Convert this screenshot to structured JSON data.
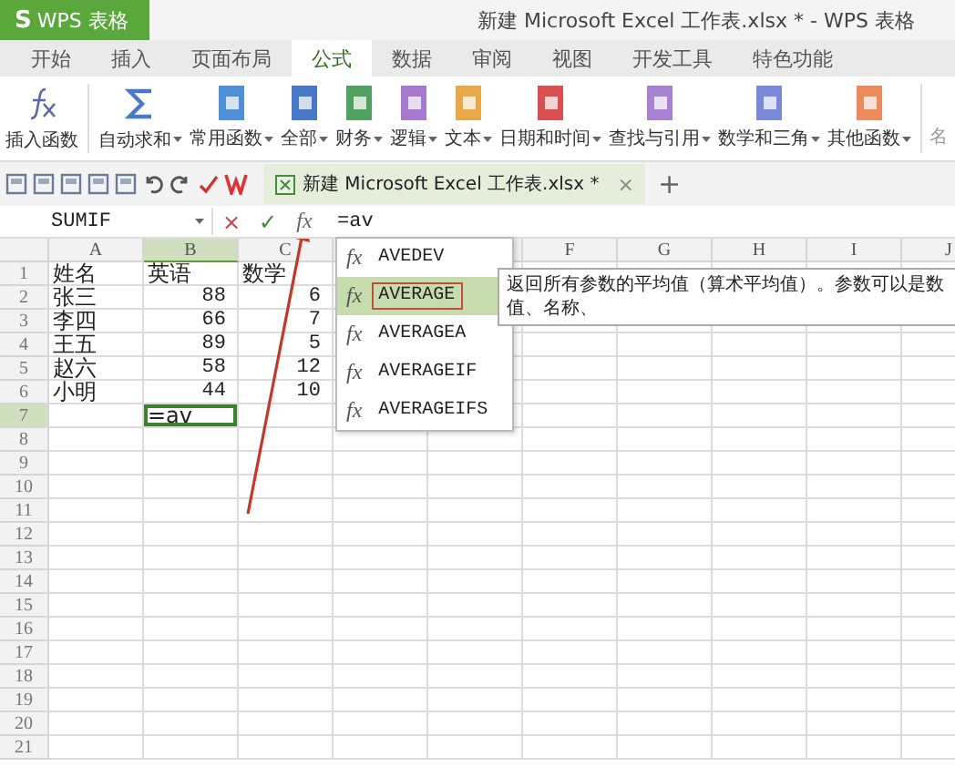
{
  "window": {
    "app_logo": "S",
    "app_name": "WPS 表格",
    "title": "新建 Microsoft Excel 工作表.xlsx * - WPS 表格"
  },
  "menu_tabs": [
    {
      "label": "开始",
      "selected": false
    },
    {
      "label": "插入",
      "selected": false
    },
    {
      "label": "页面布局",
      "selected": false
    },
    {
      "label": "公式",
      "selected": true
    },
    {
      "label": "数据",
      "selected": false
    },
    {
      "label": "审阅",
      "selected": false
    },
    {
      "label": "视图",
      "selected": false
    },
    {
      "label": "开发工具",
      "selected": false
    },
    {
      "label": "特色功能",
      "selected": false
    }
  ],
  "ribbon": {
    "buttons": [
      {
        "kind": "fx",
        "label": "插入函数",
        "dropdown": false
      },
      {
        "kind": "sigma",
        "label": "自动求和",
        "dropdown": true
      },
      {
        "kind": "book",
        "label": "常用函数",
        "dropdown": true,
        "color": "#4f8fd8"
      },
      {
        "kind": "book",
        "label": "全部",
        "dropdown": true,
        "color": "#4a78c8"
      },
      {
        "kind": "book",
        "label": "财务",
        "dropdown": true,
        "color": "#52a060"
      },
      {
        "kind": "book",
        "label": "逻辑",
        "dropdown": true,
        "color": "#a679cc"
      },
      {
        "kind": "book",
        "label": "文本",
        "dropdown": true,
        "color": "#e8a848"
      },
      {
        "kind": "book",
        "label": "日期和时间",
        "dropdown": true,
        "color": "#d85050"
      },
      {
        "kind": "book",
        "label": "查找与引用",
        "dropdown": true,
        "color": "#a882d0"
      },
      {
        "kind": "book",
        "label": "数学和三角",
        "dropdown": true,
        "color": "#7a88d8"
      },
      {
        "kind": "book",
        "label": "其他函数",
        "dropdown": true,
        "color": "#ec8a5c"
      }
    ],
    "cut_label": "名"
  },
  "document_tab": {
    "label": "新建 Microsoft Excel 工作表.xlsx *",
    "close": "×",
    "new_tab": "+"
  },
  "formula_bar": {
    "name_box": "SUMIF",
    "cancel": "×",
    "confirm": "✓",
    "fx": "fx",
    "value": "=av"
  },
  "sheet": {
    "columns": [
      {
        "label": "A",
        "selected": false
      },
      {
        "label": "B",
        "selected": true
      },
      {
        "label": "C",
        "selected": false
      },
      {
        "label": "F",
        "selected": false
      },
      {
        "label": "G",
        "selected": false
      },
      {
        "label": "H",
        "selected": false
      },
      {
        "label": "I",
        "selected": false
      },
      {
        "label": "J",
        "selected": false
      }
    ],
    "rows": [
      {
        "number": "1",
        "selected": false,
        "cells": [
          {
            "kind": "text",
            "text": "姓名"
          },
          {
            "kind": "text",
            "text": "英语"
          },
          {
            "kind": "text",
            "text": "数学"
          }
        ]
      },
      {
        "number": "2",
        "selected": false,
        "cells": [
          {
            "kind": "text",
            "text": "张三"
          },
          {
            "kind": "number",
            "text": "88"
          },
          {
            "kind": "number",
            "text": "6"
          }
        ]
      },
      {
        "number": "3",
        "selected": false,
        "cells": [
          {
            "kind": "text",
            "text": "李四"
          },
          {
            "kind": "number",
            "text": "66"
          },
          {
            "kind": "number",
            "text": "7"
          }
        ]
      },
      {
        "number": "4",
        "selected": false,
        "cells": [
          {
            "kind": "text",
            "text": "王五"
          },
          {
            "kind": "number",
            "text": "89"
          },
          {
            "kind": "number",
            "text": "5"
          }
        ]
      },
      {
        "number": "5",
        "selected": false,
        "cells": [
          {
            "kind": "text",
            "text": "赵六"
          },
          {
            "kind": "number",
            "text": "58"
          },
          {
            "kind": "number",
            "text": "12"
          }
        ]
      },
      {
        "number": "6",
        "selected": false,
        "cells": [
          {
            "kind": "text",
            "text": "小明"
          },
          {
            "kind": "number",
            "text": "44"
          },
          {
            "kind": "number",
            "text": "10"
          }
        ]
      },
      {
        "number": "7",
        "selected": true,
        "cells": [
          null,
          {
            "kind": "text",
            "text": "=av",
            "active": true
          }
        ]
      },
      {
        "number": "8",
        "selected": false
      },
      {
        "number": "9",
        "selected": false
      },
      {
        "number": "10",
        "selected": false
      },
      {
        "number": "11",
        "selected": false
      },
      {
        "number": "12",
        "selected": false
      },
      {
        "number": "13",
        "selected": false
      },
      {
        "number": "14",
        "selected": false
      },
      {
        "number": "15",
        "selected": false
      },
      {
        "number": "16",
        "selected": false
      },
      {
        "number": "17",
        "selected": false
      },
      {
        "number": "18",
        "selected": false
      },
      {
        "number": "19",
        "selected": false
      },
      {
        "number": "20",
        "selected": false
      },
      {
        "number": "21",
        "selected": false
      }
    ]
  },
  "autocomplete": {
    "items": [
      {
        "icon": "fx",
        "name": "AVEDEV",
        "selected": false
      },
      {
        "icon": "fx",
        "name": "AVERAGE",
        "selected": true
      },
      {
        "icon": "fx",
        "name": "AVERAGEA",
        "selected": false
      },
      {
        "icon": "fx",
        "name": "AVERAGEIF",
        "selected": false
      },
      {
        "icon": "fx",
        "name": "AVERAGEIFS",
        "selected": false
      }
    ]
  },
  "tooltip": {
    "text": "返回所有参数的平均值（算术平均值）。参数可以是数值、名称、"
  }
}
